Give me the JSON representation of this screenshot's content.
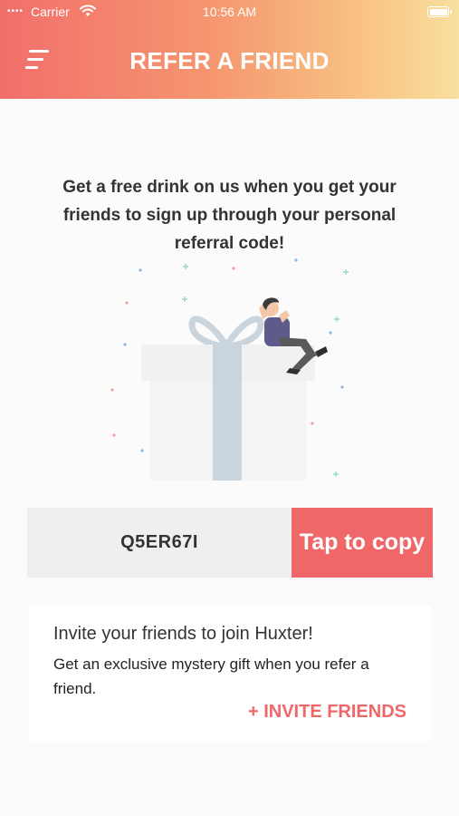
{
  "status_bar": {
    "signal": "••••",
    "carrier": "Carrier",
    "time": "10:56 AM"
  },
  "header": {
    "title": "REFER A FRIEND",
    "gradient_colors": [
      "#f26f6b",
      "#f5956f",
      "#f8c483",
      "#f8e0a0"
    ]
  },
  "intro_text": "Get a free drink on us when you get your friends to sign up through your personal referral code!",
  "referral": {
    "code": "Q5ER67I",
    "copy_label": "Tap to copy"
  },
  "invite": {
    "title": "Invite your friends to join Huxter!",
    "subtitle": "Get an exclusive mystery gift when you refer a friend.",
    "link_label": "+ INVITE FRIENDS"
  },
  "accent_color": "#f0676a"
}
